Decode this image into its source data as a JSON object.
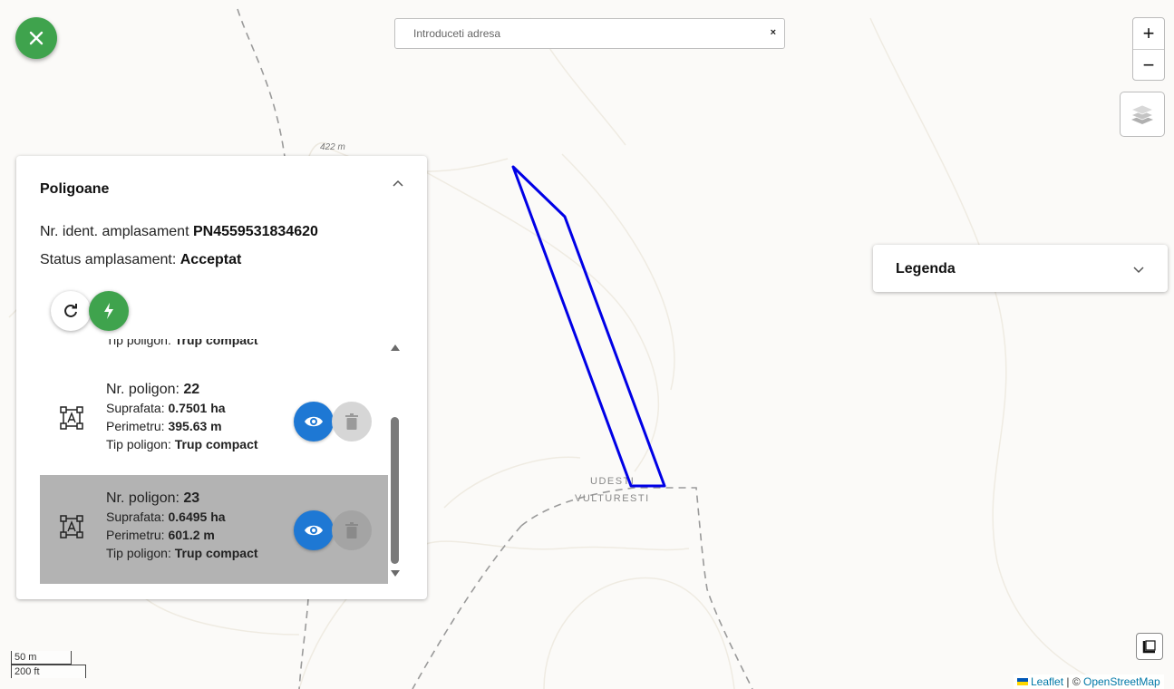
{
  "map": {
    "elevation_label": "422 m",
    "place_label_1": "UDESTI",
    "place_label_2": "VULTURESTI",
    "polygon_color": "#0000e6"
  },
  "search": {
    "placeholder": "Introduceti adresa",
    "clear_label": "×"
  },
  "zoom": {
    "in_label": "+",
    "out_label": "−"
  },
  "panel": {
    "title": "Poligoane",
    "id_label": "Nr. ident. amplasament",
    "id_value": "PN4559531834620",
    "status_label": "Status amplasament:",
    "status_value": "Acceptat",
    "partial_label": "Tip poligon:",
    "partial_value": "Trup compact",
    "items": [
      {
        "nr_label": "Nr. poligon:",
        "nr": "22",
        "area_label": "Suprafata:",
        "area": "0.7501 ha",
        "perim_label": "Perimetru:",
        "perim": "395.63 m",
        "type_label": "Tip poligon:",
        "type": "Trup compact",
        "selected": false
      },
      {
        "nr_label": "Nr. poligon:",
        "nr": "23",
        "area_label": "Suprafata:",
        "area": "0.6495 ha",
        "perim_label": "Perimetru:",
        "perim": "601.2 m",
        "type_label": "Tip poligon:",
        "type": "Trup compact",
        "selected": true
      }
    ]
  },
  "legend": {
    "title": "Legenda"
  },
  "scale": {
    "metric": "50 m",
    "imperial": "200 ft"
  },
  "attribution": {
    "leaflet": "Leaflet",
    "separator": " | © ",
    "osm": "OpenStreetMap"
  },
  "colors": {
    "accent_green": "#3fa34d",
    "accent_blue": "#1e78d4"
  }
}
